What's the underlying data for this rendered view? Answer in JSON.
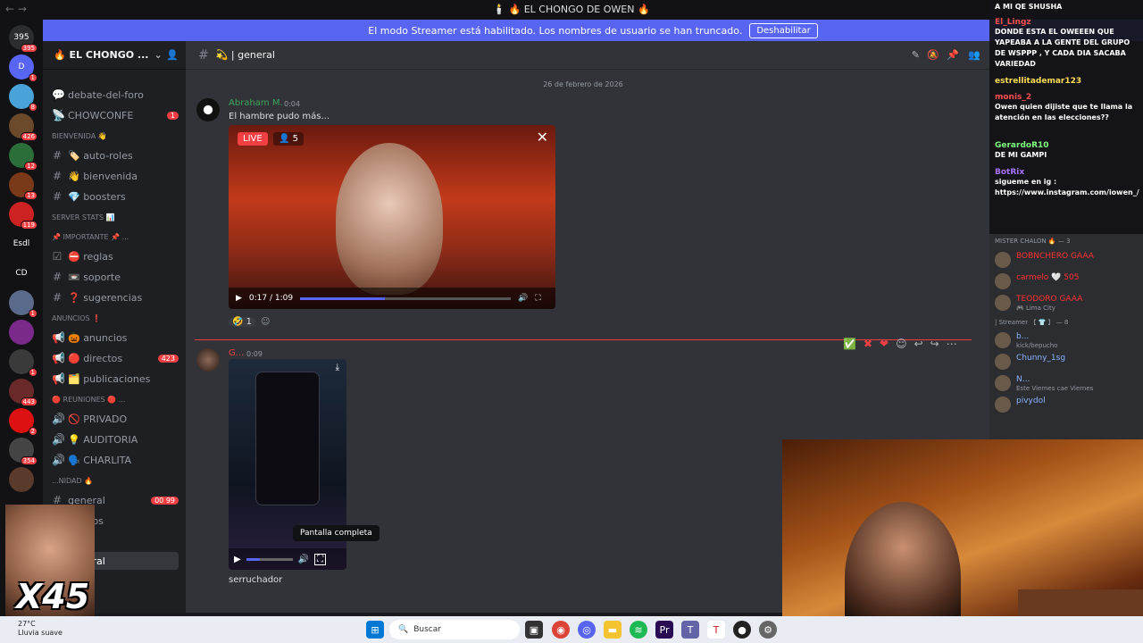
{
  "window": {
    "title": "🕯️ 🔥 EL CHONGO DE OWEN 🔥",
    "nav": "←  →"
  },
  "banner": {
    "text": "El modo Streamer está habilitado. Los nombres de usuario se han truncado.",
    "button": "Deshabilitar"
  },
  "rail": [
    {
      "label": "395",
      "badge": "395",
      "color": "#2b2d31"
    },
    {
      "label": "D",
      "badge": "1",
      "color": "#5865f2"
    },
    {
      "label": "",
      "badge": "8",
      "color": "#4aa3d8"
    },
    {
      "label": "",
      "badge": "426",
      "color": "#6a4a2a"
    },
    {
      "label": "",
      "badge": "12",
      "color": "#2c6e3a"
    },
    {
      "label": "",
      "badge": "13",
      "color": "#7a3a1a"
    },
    {
      "label": "",
      "badge": "119",
      "color": "#c22"
    },
    {
      "label": "Esdl",
      "badge": "",
      "color": "#121214"
    },
    {
      "label": "CD",
      "badge": "",
      "color": "#121214"
    },
    {
      "label": "",
      "badge": "1",
      "color": "#5a6a8a"
    },
    {
      "label": "",
      "badge": "",
      "color": "#7a2a8a"
    },
    {
      "label": "",
      "badge": "1",
      "color": "#3a3a3a"
    },
    {
      "label": "",
      "badge": "443",
      "color": "#6a2a2a"
    },
    {
      "label": "",
      "badge": "2",
      "color": "#d11"
    },
    {
      "label": "",
      "badge": "354",
      "color": "#444"
    },
    {
      "label": "",
      "badge": "",
      "color": "#5a3a2a"
    }
  ],
  "sidebar": {
    "server_name": "🔥 EL CHONGO ...",
    "items": [
      {
        "type": "forum",
        "label": "debate-del-foro",
        "icon": "forum-icon",
        "count": ""
      },
      {
        "type": "channel",
        "label": "CHOWCONFE",
        "icon": "stage-icon",
        "count": "1"
      },
      {
        "type": "category",
        "label": "BIENVENIDA 👋",
        "icon": "",
        "count": ""
      },
      {
        "type": "channel",
        "label": "🏷️ auto-roles",
        "icon": "hash-icon",
        "count": ""
      },
      {
        "type": "channel",
        "label": "👋 bienvenida",
        "icon": "hash-icon",
        "count": ""
      },
      {
        "type": "channel",
        "label": "💎 boosters",
        "icon": "hash-icon",
        "count": ""
      },
      {
        "type": "category",
        "label": "SERVER STATS 📊",
        "icon": "",
        "count": ""
      },
      {
        "type": "category",
        "label": "📌 Importante 📌 ...",
        "icon": "",
        "count": ""
      },
      {
        "type": "channel",
        "label": "⛔ reglas",
        "icon": "rules-icon",
        "count": ""
      },
      {
        "type": "channel",
        "label": "📼 soporte",
        "icon": "hash-icon",
        "count": ""
      },
      {
        "type": "channel",
        "label": "❓ sugerencias",
        "icon": "hash-icon",
        "count": ""
      },
      {
        "type": "category",
        "label": "ANUNCIOS ❗",
        "icon": "",
        "count": ""
      },
      {
        "type": "channel",
        "label": "🎃 anuncios",
        "icon": "megaphone-icon",
        "count": ""
      },
      {
        "type": "channel",
        "label": "🔴 directos",
        "icon": "megaphone-icon",
        "count": "423"
      },
      {
        "type": "channel",
        "label": "🗂️ publicaciones",
        "icon": "megaphone-icon",
        "count": ""
      },
      {
        "type": "category",
        "label": "🔴 REUNIONES 🔴 ...",
        "icon": "",
        "count": ""
      },
      {
        "type": "voice",
        "label": "🚫 PRIVADO",
        "icon": "speaker-icon",
        "count": ""
      },
      {
        "type": "voice",
        "label": "💡 AUDITORIA",
        "icon": "speaker-icon",
        "count": ""
      },
      {
        "type": "voice",
        "label": "🗣️ CHARLITA",
        "icon": "speaker-icon",
        "count": ""
      },
      {
        "type": "category",
        "label": "...NIDAD 🔥",
        "icon": "",
        "count": ""
      },
      {
        "type": "channel",
        "label": "general",
        "icon": "hash-icon",
        "count": "00 99"
      },
      {
        "type": "channel",
        "label": "Piropos",
        "icon": "hash-icon",
        "count": ""
      },
      {
        "type": "category",
        "label": "...DAD 🔥",
        "icon": "",
        "count": ""
      },
      {
        "type": "channel",
        "label": "general",
        "icon": "hash-icon",
        "count": ""
      }
    ]
  },
  "channel_header": {
    "name": "💫 | general"
  },
  "chat": {
    "date": "26 de febrero de 2026",
    "msg1": {
      "author": "Abraham M.",
      "time": "0:04",
      "text": "El hambre pudo más...",
      "live": "LIVE",
      "viewers": "5",
      "video_time": "0:17 / 1:09",
      "progress": 0.4,
      "reaction_count": "1"
    },
    "msg2": {
      "author": "G...",
      "time": "0:09",
      "tooltip": "Pantalla completa",
      "text": "serruchador",
      "progress": 0.3
    }
  },
  "overlay": {
    "lines": [
      {
        "name": "",
        "text": "A MI QE SHUSHA",
        "color": "#fff"
      },
      {
        "name": "El_Lingz",
        "text": "DONDE ESTA EL OWEEEN QUE YAPEABA A LA GENTE DEL GRUPO DE WSPPP , Y CADA DIA SACABA VARIEDAD",
        "color": "#ff4f4f"
      },
      {
        "name": "estrellitademar123",
        "text": "",
        "color": "#ffdd55"
      },
      {
        "name": "monis_2",
        "text": "Owen quien dijiste que te llama la atención en las elecciones??",
        "color": "#ff4f4f"
      },
      {
        "name": "GerardoR10",
        "text": "DE MI GAMPI",
        "color": "#7fff7f"
      },
      {
        "name": "BotRix",
        "text": "sigueme en ig : https://www.instagram.com/iowen_/",
        "color": "#a970ff"
      }
    ]
  },
  "members": {
    "groups": [
      {
        "label": "MISTER CHALON 🔥 — 3",
        "members": [
          {
            "name": "BOBNCHERO",
            "tag": "GAAA",
            "sub": "",
            "color": "#ff3030"
          },
          {
            "name": "carmelo",
            "tag": "🤍 505",
            "sub": "",
            "color": "#ff3030"
          },
          {
            "name": "TEODORO",
            "tag": "GAAA",
            "sub": "🎮 Lima City",
            "color": "#ff3030"
          }
        ]
      },
      {
        "label": "| Streamer 【 👕 】 — 8",
        "members": [
          {
            "name": "b...",
            "tag": "",
            "sub": "kick/bepucho",
            "color": "#8ab4ff"
          },
          {
            "name": "Chunny_1sg",
            "tag": "",
            "sub": "",
            "color": "#8ab4ff"
          },
          {
            "name": "N...",
            "tag": "",
            "sub": "Este Viernes cae Viernes",
            "color": "#8ab4ff"
          },
          {
            "name": "pivydol",
            "tag": "",
            "sub": "",
            "color": "#8ab4ff"
          }
        ]
      }
    ]
  },
  "meme": {
    "text": "X45"
  },
  "taskbar": {
    "temp": "27°C",
    "weather": "Lluvia suave",
    "search_placeholder": "Buscar"
  }
}
